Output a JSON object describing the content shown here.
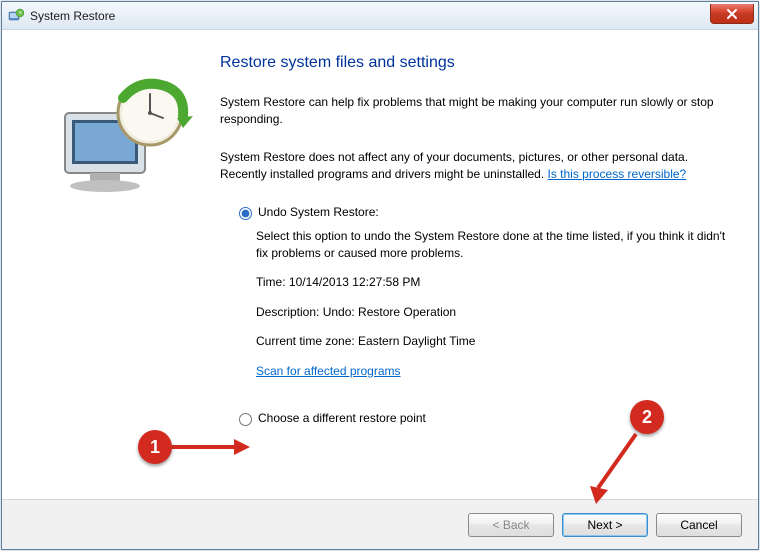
{
  "window": {
    "title": "System Restore",
    "close_label": "X"
  },
  "heading": "Restore system files and settings",
  "intro": "System Restore can help fix problems that might be making your computer run slowly or stop responding.",
  "warning_text": "System Restore does not affect any of your documents, pictures, or other personal data. Recently installed programs and drivers might be uninstalled. ",
  "warning_link": "Is this process reversible?",
  "option1": {
    "label": "Undo System Restore:",
    "desc": "Select this option to undo the System Restore done at the time listed, if you think it didn't fix problems or caused more problems.",
    "time_label": "Time: ",
    "time_value": "10/14/2013 12:27:58 PM",
    "desc_label": "Description: ",
    "desc_value": "Undo: Restore Operation",
    "tz_label": "Current time zone: ",
    "tz_value": "Eastern Daylight Time",
    "scan_link": "Scan for affected programs"
  },
  "option2": {
    "label": "Choose a different restore point"
  },
  "buttons": {
    "back": "< Back",
    "next": "Next >",
    "cancel": "Cancel"
  },
  "annotations": {
    "label1": "1",
    "label2": "2"
  }
}
